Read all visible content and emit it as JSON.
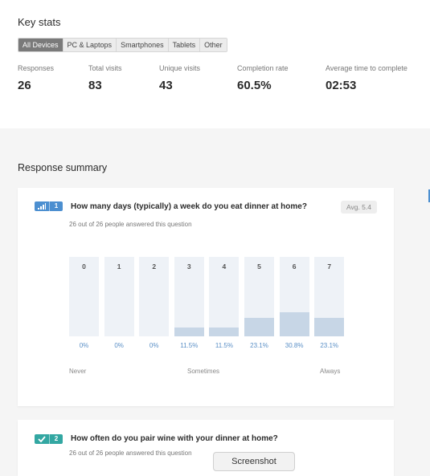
{
  "key_stats": {
    "title": "Key stats",
    "filters": [
      "All Devices",
      "PC & Laptops",
      "Smartphones",
      "Tablets",
      "Other"
    ],
    "active_filter": 0,
    "stats": [
      {
        "label": "Responses",
        "value": "26"
      },
      {
        "label": "Total visits",
        "value": "83"
      },
      {
        "label": "Unique visits",
        "value": "43"
      },
      {
        "label": "Completion rate",
        "value": "60.5%"
      },
      {
        "label": "Average time to complete",
        "value": "02:53"
      }
    ]
  },
  "response_summary": {
    "title": "Response summary",
    "questions": [
      {
        "number": "1",
        "icon": "bar-chart-icon",
        "text": "How many days (typically) a week do you eat dinner at home?",
        "answered": "26 out of 26 people answered this question",
        "avg": "Avg. 5.4",
        "chart_data": {
          "type": "bar",
          "categories": [
            "0",
            "1",
            "2",
            "3",
            "4",
            "5",
            "6",
            "7"
          ],
          "values": [
            0,
            0,
            0,
            11.5,
            11.5,
            23.1,
            30.8,
            23.1
          ],
          "value_labels": [
            "0%",
            "0%",
            "0%",
            "11.5%",
            "11.5%",
            "23.1%",
            "30.8%",
            "23.1%"
          ],
          "ylim": [
            0,
            100
          ]
        },
        "scale_labels": [
          "Never",
          "Sometimes",
          "Always"
        ]
      },
      {
        "number": "2",
        "icon": "checkmark-icon",
        "text": "How often do you pair wine with your dinner at home?",
        "answered": "26 out of 26 people answered this question"
      }
    ]
  },
  "screenshot_button": "Screenshot",
  "colors": {
    "accent_blue": "#4c8fd0",
    "accent_teal": "#33a7a2",
    "bar_fill": "#c7d6e6",
    "bar_bg": "#eef2f7"
  }
}
